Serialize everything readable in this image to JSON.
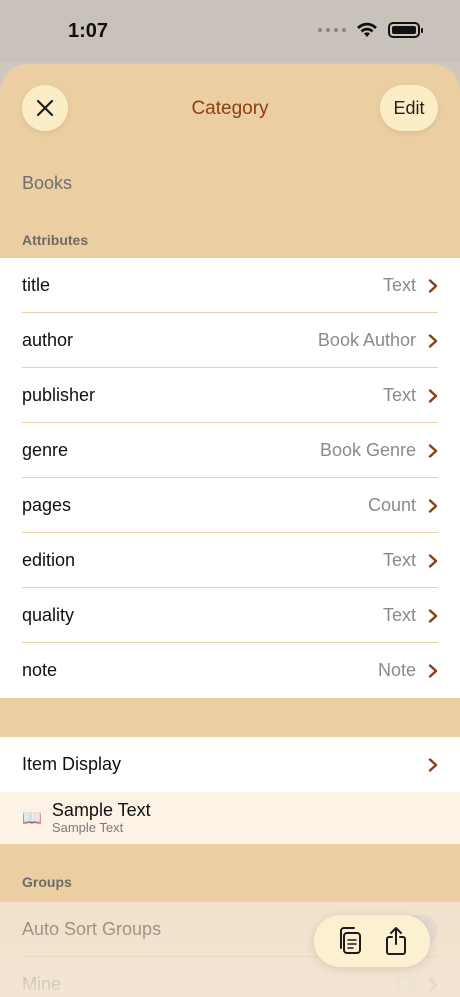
{
  "status": {
    "time": "1:07"
  },
  "nav": {
    "title": "Category",
    "edit_label": "Edit"
  },
  "category": {
    "name": "Books"
  },
  "attributes": {
    "header": "Attributes",
    "rows": [
      {
        "label": "title",
        "value": "Text"
      },
      {
        "label": "author",
        "value": "Book Author"
      },
      {
        "label": "publisher",
        "value": "Text"
      },
      {
        "label": "genre",
        "value": "Book Genre"
      },
      {
        "label": "pages",
        "value": "Count"
      },
      {
        "label": "edition",
        "value": "Text"
      },
      {
        "label": "quality",
        "value": "Text"
      },
      {
        "label": "note",
        "value": "Note"
      }
    ]
  },
  "item_display": {
    "label": "Item Display",
    "sample_title": "Sample Text",
    "sample_subtitle": "Sample Text",
    "icon": "book-icon"
  },
  "groups": {
    "header": "Groups",
    "auto_sort_label": "Auto Sort Groups",
    "mine_label": "Mine",
    "mine_count": "0"
  },
  "colors": {
    "accent": "#8c3f12",
    "sheet": "#ebcea2",
    "button": "#fbedc6"
  }
}
